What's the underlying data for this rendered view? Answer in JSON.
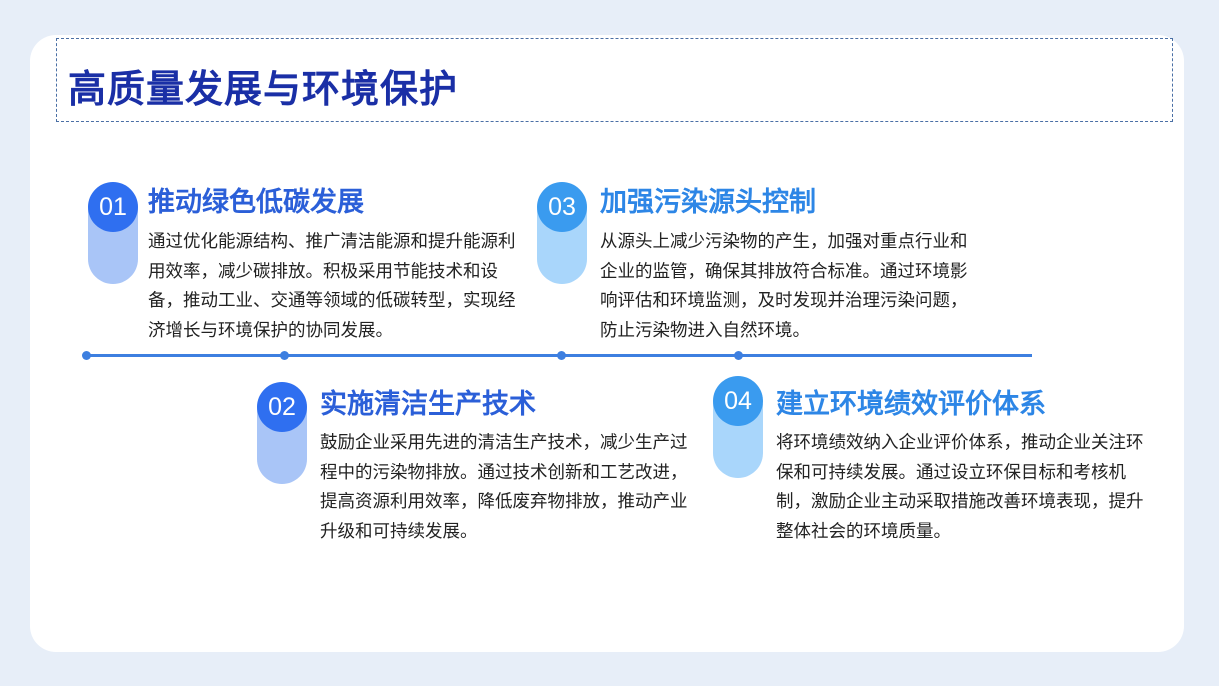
{
  "page": {
    "title": "高质量发展与环境保护"
  },
  "items": [
    {
      "number": "01",
      "heading": "推动绿色低碳发展",
      "text": "通过优化能源结构、推广清洁能源和提升能源利用效率，减少碳排放。积极采用节能技术和设备，推动工业、交通等领域的低碳转型，实现经济增长与环境保护的协同发展。"
    },
    {
      "number": "02",
      "heading": "实施清洁生产技术",
      "text": "鼓励企业采用先进的清洁生产技术，减少生产过程中的污染物排放。通过技术创新和工艺改进，提高资源利用效率，降低废弃物排放，推动产业升级和可持续发展。"
    },
    {
      "number": "03",
      "heading": "加强污染源头控制",
      "text": "从源头上减少污染物的产生，加强对重点行业和企业的监管，确保其排放符合标准。通过环境影响评估和环境监测，及时发现并治理污染问题，防止污染物进入自然环境。"
    },
    {
      "number": "04",
      "heading": "建立环境绩效评价体系",
      "text": "将环境绩效纳入企业评价体系，推动企业关注环保和可持续发展。通过设立环保目标和考核机制，激励企业主动采取措施改善环境表现，提升整体社会的环境质量。"
    }
  ],
  "colors": {
    "title": "#1a2fa6",
    "accent_dark": "#2f6ff0",
    "accent_light": "#3a9bef",
    "timeline": "#3d7fe0"
  }
}
